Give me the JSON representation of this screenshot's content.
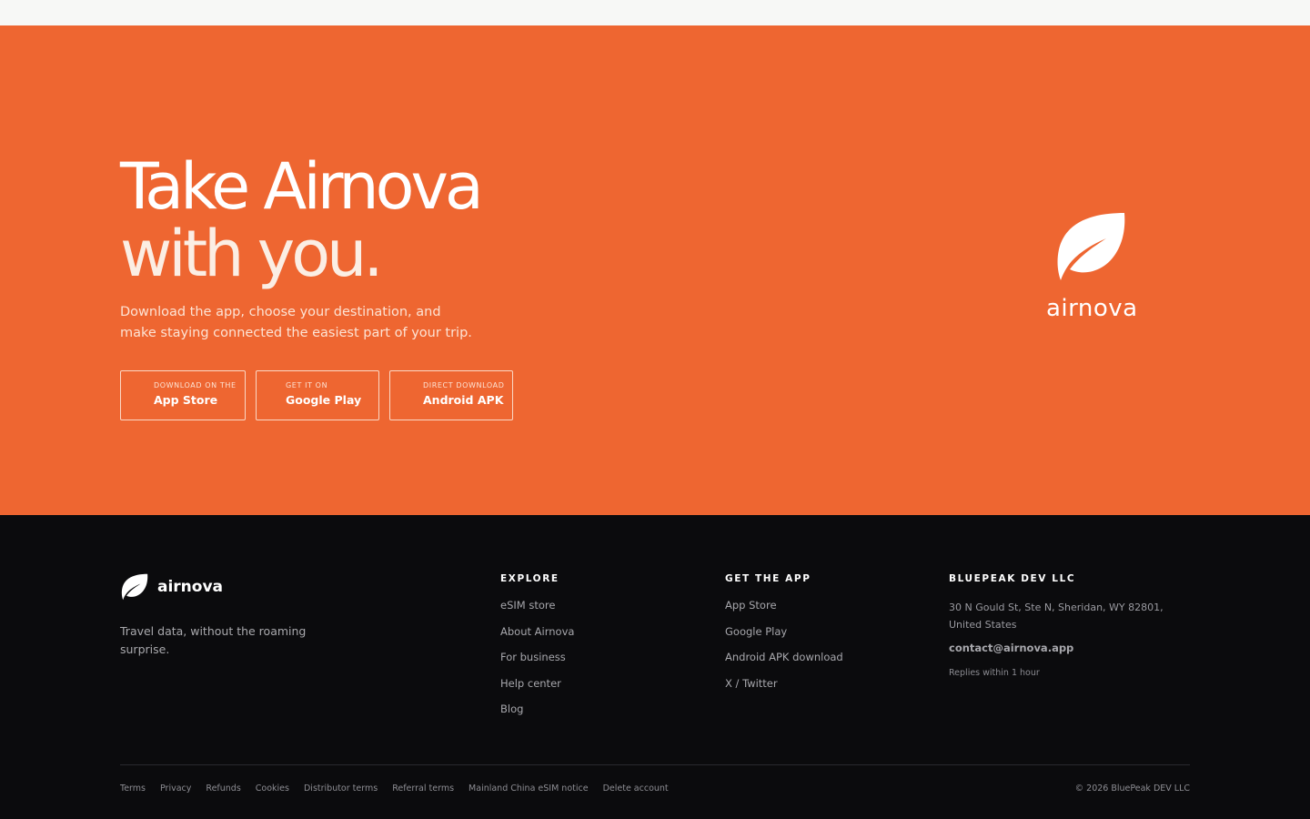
{
  "colors": {
    "hero_bg": "#ee6631",
    "footer_bg": "#0b0b0d",
    "topbar_bg": "#f7f8f6"
  },
  "hero": {
    "title_line1": "Take Airnova",
    "title_line2": "with you.",
    "subtitle": "Download the app, choose your destination, and make staying connected the easiest part of your trip.",
    "buttons": [
      {
        "small": "Download on the",
        "big": "App Store",
        "icon": "apple-icon"
      },
      {
        "small": "Get it on",
        "big": "Google Play",
        "icon": "google-play-icon"
      },
      {
        "small": "Direct download",
        "big": "Android APK",
        "icon": "android-icon"
      }
    ],
    "brand_word": "airnova",
    "brand_icon": "leaf-icon"
  },
  "footer": {
    "brand": "airnova",
    "tagline": "Travel data, without the roaming surprise.",
    "explore": {
      "heading": "EXPLORE",
      "links": [
        "eSIM store",
        "About Airnova",
        "For business",
        "Help center",
        "Blog"
      ]
    },
    "get_app": {
      "heading": "GET THE APP",
      "links": [
        "App Store",
        "Google Play",
        "Android APK download",
        "X / Twitter"
      ]
    },
    "company": {
      "heading": "BLUEPEAK DEV LLC",
      "address": "30 N Gould St, Ste N, Sheridan, WY 82801, United States",
      "email": "contact@airnova.app",
      "reply": "Replies within 1 hour"
    },
    "legal_links": [
      "Terms",
      "Privacy",
      "Refunds",
      "Cookies",
      "Distributor terms",
      "Referral terms",
      "Mainland China eSIM notice",
      "Delete account"
    ],
    "copyright": "© 2026 BluePeak DEV LLC"
  }
}
